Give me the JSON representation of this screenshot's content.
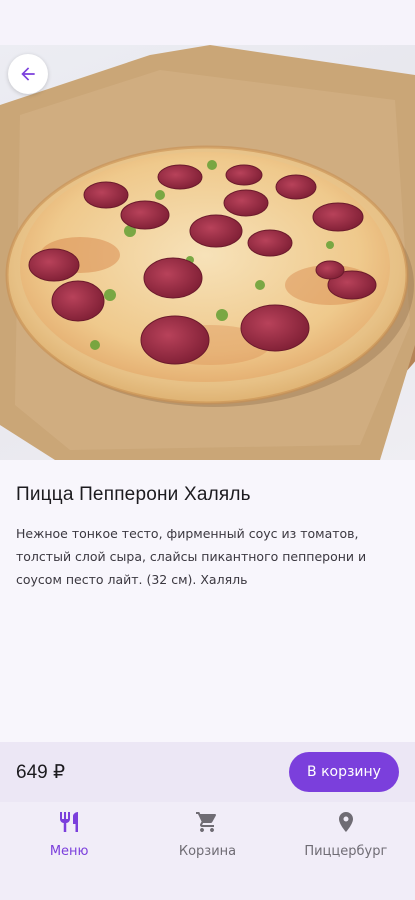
{
  "product": {
    "title": "Пицца Пепперони Халяль",
    "description": "Нежное тонкое тесто, фирменный соус из томатов, толстый слой сыра, слайсы пикантного пепперони и соусом песто лайт. (32 см). Халяль",
    "image_icon": "pizza-photo"
  },
  "purchase": {
    "price": "649 ₽",
    "add_to_cart_label": "В корзину"
  },
  "bottom_nav": {
    "items": [
      {
        "label": "Меню",
        "icon": "fork-knife-icon",
        "active": true
      },
      {
        "label": "Корзина",
        "icon": "cart-icon",
        "active": false
      },
      {
        "label": "Пиццербург",
        "icon": "location-pin-icon",
        "active": false
      }
    ]
  },
  "colors": {
    "accent": "#7b3fdc",
    "background": "#f6f3fb",
    "nav_inactive": "#6f6c74"
  }
}
